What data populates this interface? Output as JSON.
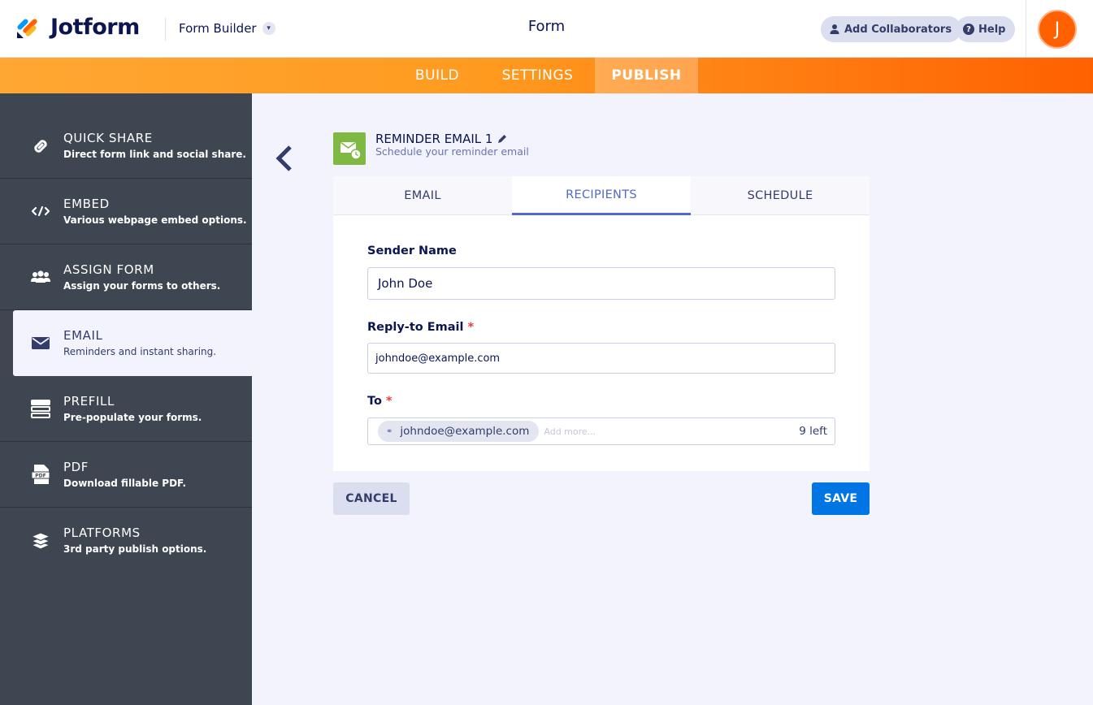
{
  "header": {
    "brand": "Jotform",
    "builder_label": "Form Builder",
    "title": "Form",
    "add_collaborators": "Add Collaborators",
    "help": "Help",
    "avatar_initial": "J"
  },
  "nav": {
    "tabs": [
      {
        "label": "BUILD"
      },
      {
        "label": "SETTINGS"
      },
      {
        "label": "PUBLISH",
        "active": true
      }
    ]
  },
  "sidebar": {
    "items": [
      {
        "title": "QUICK SHARE",
        "desc": "Direct form link and social share.",
        "icon": "link-icon"
      },
      {
        "title": "EMBED",
        "desc": "Various webpage embed options.",
        "icon": "code-icon"
      },
      {
        "title": "ASSIGN FORM",
        "desc": "Assign your forms to others.",
        "icon": "users-icon"
      },
      {
        "title": "EMAIL",
        "desc": "Reminders and instant sharing.",
        "icon": "envelope-icon",
        "active": true
      },
      {
        "title": "PREFILL",
        "desc": "Pre-populate your forms.",
        "icon": "prefill-icon"
      },
      {
        "title": "PDF",
        "desc": "Download fillable PDF.",
        "icon": "pdf-icon",
        "icon_text": "PDF"
      },
      {
        "title": "PLATFORMS",
        "desc": "3rd party publish options.",
        "icon": "layers-icon"
      }
    ]
  },
  "panel": {
    "title": "REMINDER EMAIL 1",
    "subtitle": "Schedule your reminder email",
    "tabs": [
      {
        "label": "EMAIL"
      },
      {
        "label": "RECIPIENTS",
        "active": true
      },
      {
        "label": "SCHEDULE"
      }
    ],
    "sender_name": {
      "label": "Sender Name",
      "value": "John Doe"
    },
    "reply_to": {
      "label": "Reply-to Email",
      "required_mark": "*",
      "value": "johndoe@example.com"
    },
    "to": {
      "label": "To",
      "required_mark": "*",
      "chip": "johndoe@example.com",
      "placeholder": "Add more...",
      "remaining": "9 left"
    },
    "cancel": "CANCEL",
    "save": "SAVE"
  },
  "colors": {
    "accent_orange": "#ff6100",
    "sidebar_bg": "#3e4652",
    "active_tab": "#5369c9",
    "save_blue": "#0075e3",
    "email_badge": "#7fb842"
  }
}
